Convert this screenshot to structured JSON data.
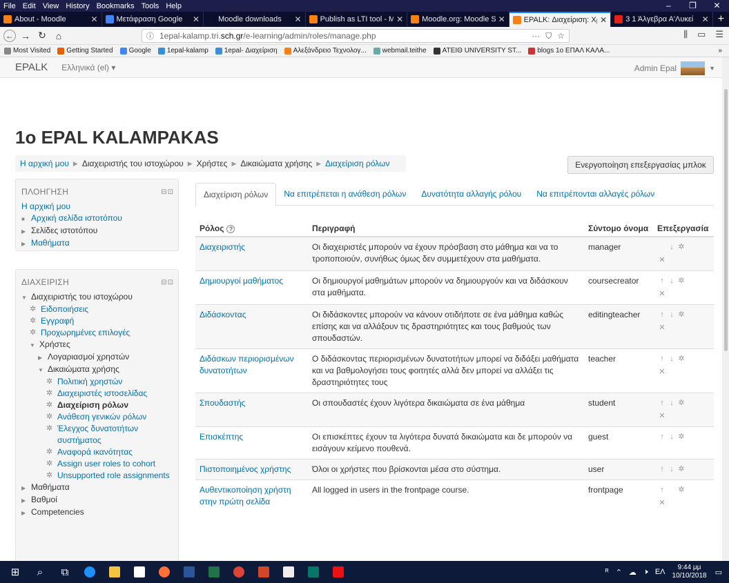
{
  "menubar": {
    "items": [
      "File",
      "Edit",
      "View",
      "History",
      "Bookmarks",
      "Tools",
      "Help"
    ],
    "window_controls": [
      "–",
      "❐",
      "✕"
    ]
  },
  "browser_tabs": [
    {
      "label": "About - Moodle",
      "color": "#f98012"
    },
    {
      "label": "Μετάφραση Google",
      "color": "#4285f4"
    },
    {
      "label": "Moodle downloads",
      "color": ""
    },
    {
      "label": "Publish as LTI tool - M",
      "color": "#f98012"
    },
    {
      "label": "Moodle.org: Moodle S",
      "color": "#f98012"
    },
    {
      "label": "EPALK: Διαχείριση: Χρ",
      "color": "#f98012",
      "active": true
    },
    {
      "label": "3 1 Άλγεβρα Α'Λυκεί",
      "color": "#e62117"
    }
  ],
  "navbar": {
    "url_prefix": "1epal-kalamp.tri.",
    "url_host": "sch.gr",
    "url_path": "/e-learning/admin/roles/manage.php",
    "more": "···"
  },
  "bookmarks": [
    {
      "label": "Most Visited",
      "color": "#888"
    },
    {
      "label": "Getting Started",
      "color": "#e66000"
    },
    {
      "label": "Google",
      "color": "#4285f4"
    },
    {
      "label": "1epal-kalamp",
      "color": "#3a8fd8"
    },
    {
      "label": "1epal- Διαχείριση",
      "color": "#3a8fd8"
    },
    {
      "label": "Αλεξάνδρειο Τεχνολογ...",
      "color": "#f98012"
    },
    {
      "label": "webmail.teithe",
      "color": "#6aa"
    },
    {
      "label": "ATEIΘ UNIVERSITY ST...",
      "color": "#333"
    },
    {
      "label": "blogs 1ο ΕΠΑΛ ΚΑΛΑ...",
      "color": "#c33"
    }
  ],
  "site": {
    "brand": "EPALK",
    "language": "Ελληνικά (el) ▾",
    "user": "Admin Epal",
    "title": "1ο EPAL KALAMPAKAS"
  },
  "breadcrumb": [
    {
      "label": "Η αρχική μου",
      "link": true
    },
    {
      "label": "Διαχειριστής του ιστοχώρου",
      "link": false
    },
    {
      "label": "Χρήστες",
      "link": false
    },
    {
      "label": "Δικαιώματα χρήσης",
      "link": false
    },
    {
      "label": "Διαχείριση ρόλων",
      "link": true
    }
  ],
  "block_editing_button": "Ενεργοποίηση επεξεργασίας μπλοκ",
  "nav_block": {
    "title": "ΠΛΟΗΓΗΣΗ",
    "items": [
      {
        "label": "Η αρχική μου",
        "type": "link",
        "indent": 1,
        "bullet": ""
      },
      {
        "label": "Αρχική σελίδα ιστοτόπου",
        "type": "link",
        "indent": 1,
        "bullet": "■"
      },
      {
        "label": "Σελίδες ιστοτόπου",
        "type": "text",
        "indent": 1,
        "bullet": "▶"
      },
      {
        "label": "Μαθήματα",
        "type": "link",
        "indent": 1,
        "bullet": "▶"
      }
    ]
  },
  "admin_block": {
    "title": "ΔΙΑΧΕΙΡΙΣΗ",
    "items": [
      {
        "label": "Διαχειριστής του ιστοχώρου",
        "type": "text",
        "indent": 1,
        "bullet": "▼"
      },
      {
        "label": "Ειδοποιήσεις",
        "type": "link",
        "indent": 2,
        "bullet": "gear"
      },
      {
        "label": "Εγγραφή",
        "type": "link",
        "indent": 2,
        "bullet": "gear"
      },
      {
        "label": "Προχωρημένες επιλογές",
        "type": "link",
        "indent": 2,
        "bullet": "gear"
      },
      {
        "label": "Χρήστες",
        "type": "text",
        "indent": 2,
        "bullet": "▼"
      },
      {
        "label": "Λογαριασμοί χρηστών",
        "type": "text",
        "indent": 3,
        "bullet": "▶"
      },
      {
        "label": "Δικαιώματα χρήσης",
        "type": "text",
        "indent": 3,
        "bullet": "▼"
      },
      {
        "label": "Πολιτική χρηστών",
        "type": "link",
        "indent": 4,
        "bullet": "gear"
      },
      {
        "label": "Διαχειριστές ιστοσελίδας",
        "type": "link",
        "indent": 4,
        "bullet": "gear"
      },
      {
        "label": "Διαχείριση ρόλων",
        "type": "link",
        "indent": 4,
        "bullet": "gear",
        "current": true
      },
      {
        "label": "Ανάθεση γενικών ρόλων",
        "type": "link",
        "indent": 4,
        "bullet": "gear"
      },
      {
        "label": "Έλεγχος δυνατοτήτων συστήματος",
        "type": "link",
        "indent": 4,
        "bullet": "gear"
      },
      {
        "label": "Αναφορά ικανότητας",
        "type": "link",
        "indent": 4,
        "bullet": "gear"
      },
      {
        "label": "Assign user roles to cohort",
        "type": "link",
        "indent": 4,
        "bullet": "gear"
      },
      {
        "label": "Unsupported role assignments",
        "type": "link",
        "indent": 4,
        "bullet": "gear"
      },
      {
        "label": "Μαθήματα",
        "type": "text",
        "indent": 1,
        "bullet": "▶"
      },
      {
        "label": "Βαθμοί",
        "type": "text",
        "indent": 1,
        "bullet": "▶"
      },
      {
        "label": "Competencies",
        "type": "text",
        "indent": 1,
        "bullet": "▶"
      }
    ]
  },
  "main_tabs": [
    {
      "label": "Διαχείριση ρόλων",
      "active": true
    },
    {
      "label": "Να επιτρέπεται η ανάθεση ρόλων",
      "active": false
    },
    {
      "label": "Δυνατότητα αλλαγής ρόλου",
      "active": false
    },
    {
      "label": "Να επιτρέπονται αλλαγές ρόλων",
      "active": false
    }
  ],
  "roles_table": {
    "headers": {
      "role": "Ρόλος",
      "description": "Περιγραφή",
      "shortname": "Σύντομο όνομα",
      "edit": "Επεξεργασία"
    },
    "rows": [
      {
        "role": "Διαχειριστής",
        "description": "Οι διαχειριστές μπορούν να έχουν πρόσβαση στο μάθημα και να το τροποποιούν, συνήθως όμως δεν συμμετέχουν στα μαθήματα.",
        "shortname": "manager",
        "up": false,
        "down": true,
        "delete": true
      },
      {
        "role": "Δημιουργοί μαθήματος",
        "description": "Οι δημιουργοί μαθημάτων μπορούν να δημιουργούν και να διδάσκουν στα μαθήματα.",
        "shortname": "coursecreator",
        "up": true,
        "down": true,
        "delete": true
      },
      {
        "role": "Διδάσκοντας",
        "description": "Οι διδάσκοντες μπορούν να κάνουν οτιδήποτε σε ένα μάθημα καθώς επίσης και να αλλάξουν τις δραστηριότητες και τους βαθμούς των σπουδαστών.",
        "shortname": "editingteacher",
        "up": true,
        "down": true,
        "delete": true
      },
      {
        "role": "Διδάσκων περιορισμένων δυνατοτήτων",
        "description": "Ο διδάσκοντας περιορισμένων δυνατοτήτων μπορεί να διδάξει μαθήματα και να βαθμολογήσει τους φοιτητές αλλά δεν μπορεί να αλλάξει τις δραστηριότητες τους",
        "shortname": "teacher",
        "up": true,
        "down": true,
        "delete": true
      },
      {
        "role": "Σπουδαστής",
        "description": "Οι σπουδαστές έχουν λιγότερα δικαιώματα σε ένα μάθημα",
        "shortname": "student",
        "up": true,
        "down": true,
        "delete": true
      },
      {
        "role": "Επισκέπτης",
        "description": "Οι επισκέπτες έχουν τα λιγότερα δυνατά δικαιώματα και δε μπορούν να εισάγουν κείμενο πουθενά.",
        "shortname": "guest",
        "up": true,
        "down": true,
        "delete": false
      },
      {
        "role": "Πιστοποιημένος χρήστης",
        "description": "Όλοι οι χρήστες που βρίσκονται μέσα στο σύστημα.",
        "shortname": "user",
        "up": true,
        "down": true,
        "delete": false
      },
      {
        "role": "Αυθεντικοποίηση χρήστη στην πρώτη σελίδα",
        "description": "All logged in users in the frontpage course.",
        "shortname": "frontpage",
        "up": true,
        "down": false,
        "delete": true
      }
    ]
  },
  "taskbar": {
    "lang": "ΕΛ",
    "time": "9:44 μμ",
    "date": "10/10/2018"
  }
}
